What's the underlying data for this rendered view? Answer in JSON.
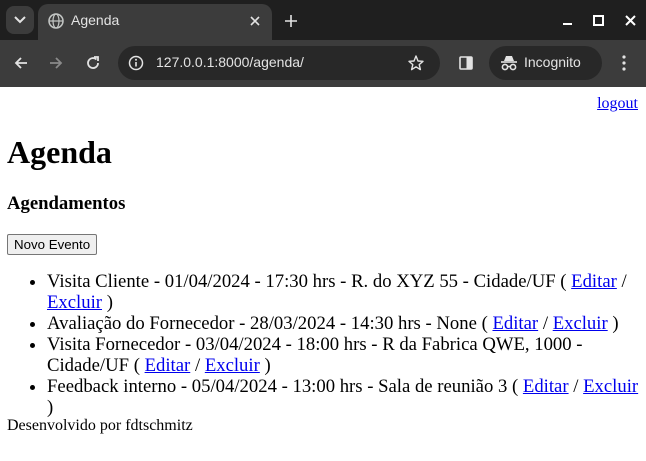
{
  "browser": {
    "tab_title": "Agenda",
    "url": "127.0.0.1:8000/agenda/",
    "incognito_label": "Incognito"
  },
  "page": {
    "logout_label": "logout",
    "title": "Agenda",
    "subtitle": "Agendamentos",
    "new_event_label": "Novo Evento",
    "edit_label": "Editar",
    "delete_label": "Excluir",
    "separator": " / ",
    "events": [
      {
        "text": "Visita Cliente - 01/04/2024 - 17:30 hrs - R. do XYZ 55 - Cidade/UF"
      },
      {
        "text": "Avaliação do Fornecedor - 28/03/2024 - 14:30 hrs - None"
      },
      {
        "text": "Visita Fornecedor - 03/04/2024 - 18:00 hrs - R da Fabrica QWE, 1000 - Cidade/UF"
      },
      {
        "text": "Feedback interno - 05/04/2024 - 13:00 hrs - Sala de reunião 3"
      }
    ],
    "footer": "Desenvolvido por fdtschmitz"
  }
}
